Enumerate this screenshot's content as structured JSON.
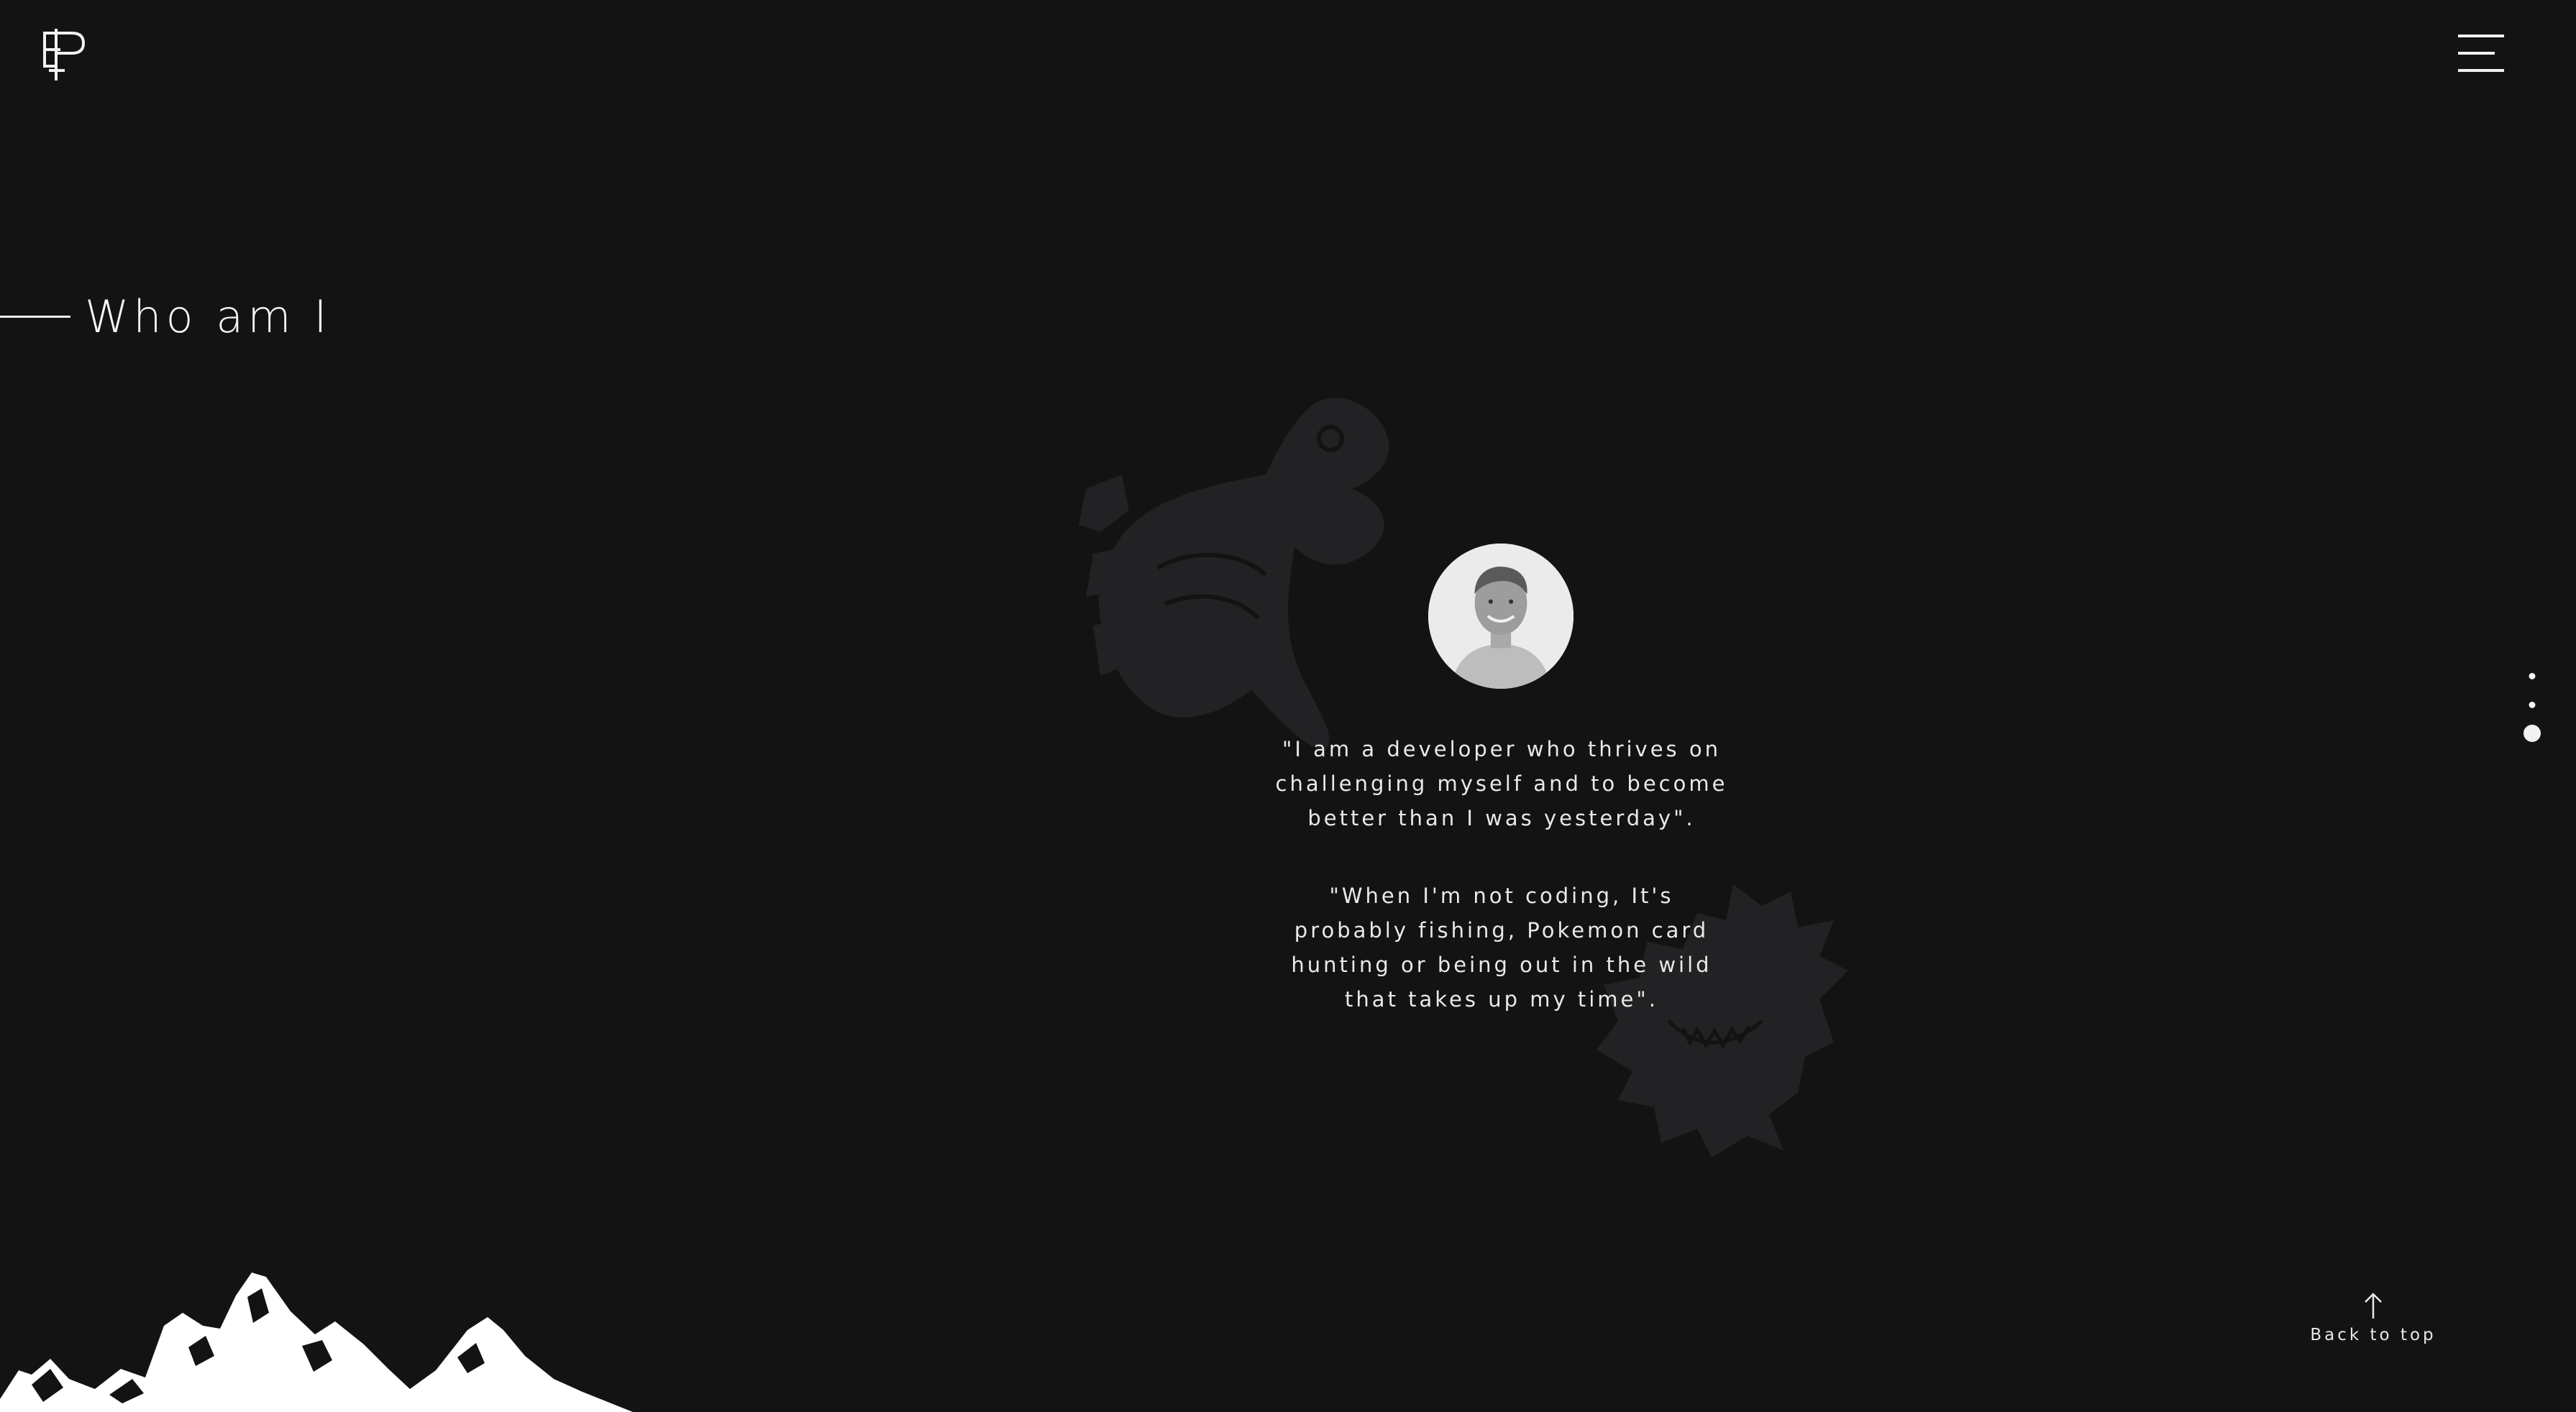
{
  "logo": {
    "icon": "ep-monogram-logo"
  },
  "menu": {
    "icon": "hamburger-menu-icon"
  },
  "section": {
    "title": "Who am I"
  },
  "profile": {
    "icon": "profile-photo"
  },
  "quotes": [
    "\"I am a developer who thrives on challenging myself and to become better than I was yesterday\".",
    "\"When I'm not coding, It's probably fishing, Pokemon card hunting or being out in the wild that takes up my time\"."
  ],
  "pager": {
    "count": 3,
    "active_index": 2
  },
  "back_to_top": {
    "label": "Back to top",
    "icon": "arrow-up-icon"
  },
  "decor": {
    "fish": "fish-illustration",
    "ghost": "ghost-creature-illustration",
    "mountains": "mountain-silhouette"
  },
  "colors": {
    "background": "#131314",
    "foreground": "#f2f2f2",
    "decor": "#232325"
  }
}
